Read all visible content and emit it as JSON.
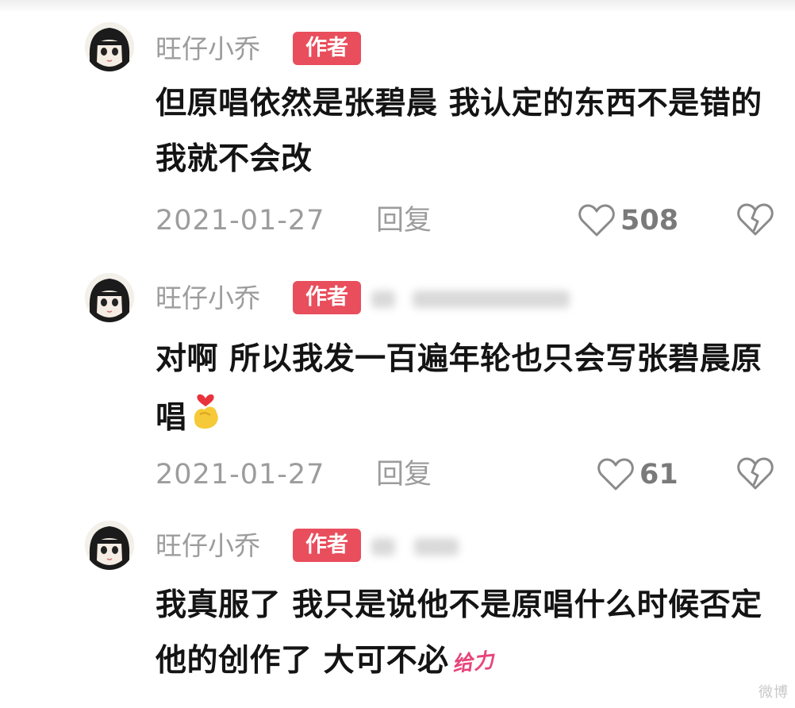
{
  "comments": [
    {
      "username": "旺仔小乔",
      "badge": "作者",
      "text": "但原唱依然是张碧晨 我认定的东西不是错的我就不会改",
      "date": "2021-01-27",
      "reply_label": "回复",
      "likes": "508"
    },
    {
      "username": "旺仔小乔",
      "badge": "作者",
      "text": "对啊 所以我发一百遍年轮也只会写张碧晨原唱",
      "date": "2021-01-27",
      "reply_label": "回复",
      "likes": "61"
    },
    {
      "username": "旺仔小乔",
      "badge": "作者",
      "text": "我真服了 我只是说他不是原唱什么时候否定他的创作了 大可不必",
      "sticker": "给力"
    }
  ],
  "watermark": "微博",
  "colors": {
    "badge": "#e94e5c",
    "meta_text": "#9c9c9c",
    "body_text": "#141414"
  },
  "icons": {
    "like": "heart-outline-icon",
    "dislike": "broken-heart-icon",
    "emoji": "heart-hands-emoji-icon"
  }
}
